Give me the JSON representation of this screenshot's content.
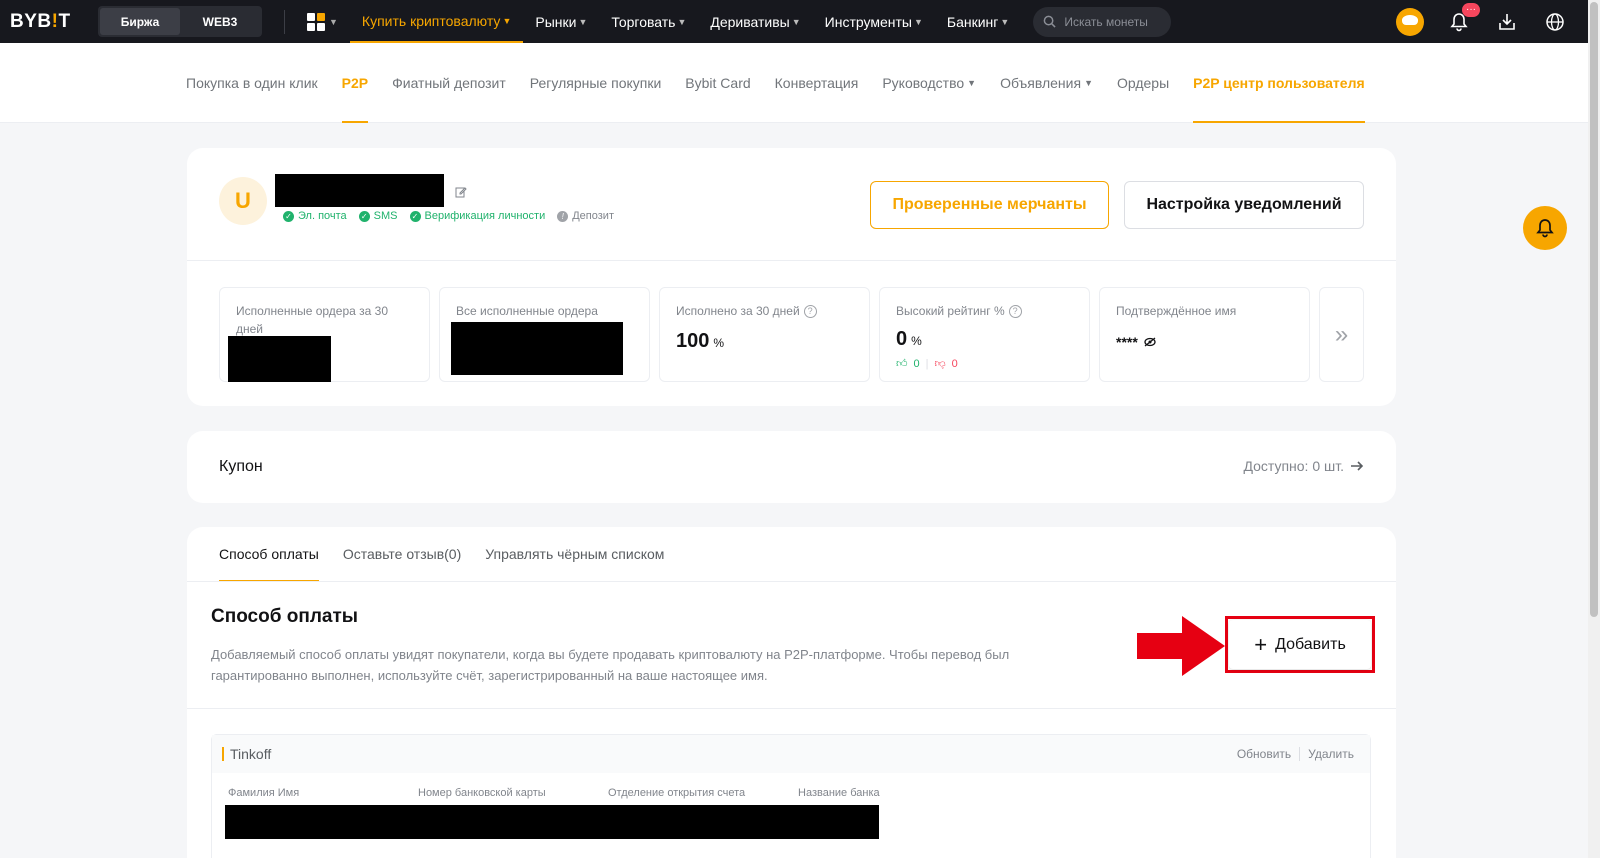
{
  "topbar": {
    "logo": "BYB",
    "logo_bar": "!",
    "logo_end": "T",
    "segments": [
      "Биржа",
      "WEB3"
    ],
    "nav": [
      {
        "label": "Купить криптовалюту",
        "active": true
      },
      {
        "label": "Рынки"
      },
      {
        "label": "Торговать"
      },
      {
        "label": "Деривативы"
      },
      {
        "label": "Инструменты"
      },
      {
        "label": "Банкинг"
      }
    ],
    "search_placeholder": "Искать монеты",
    "notif_badge": "···"
  },
  "subnav": [
    "Покупка в один клик",
    "P2P",
    "Фиатный депозит",
    "Регулярные покупки",
    "Bybit Card",
    "Конвертация",
    "Руководство",
    "Объявления",
    "Ордеры",
    "P2P центр пользователя"
  ],
  "profile": {
    "avatar_letter": "U",
    "badges": {
      "email": "Эл. почта",
      "sms": "SMS",
      "kyc": "Верификация личности",
      "deposit": "Депозит"
    },
    "btn_merchants": "Проверенные мерчанты",
    "btn_notifications": "Настройка уведомлений",
    "stats": {
      "orders30_label": "Исполненные ордера за 30 дней",
      "orders_all_label": "Все исполненные ордера",
      "completion_label": "Исполнено за 30 дней",
      "completion_value": "100",
      "rating_label": "Высокий рейтинг %",
      "rating_value": "0",
      "percent": "%",
      "likes": "0",
      "dislikes": "0",
      "name_label": "Подтверждённое имя",
      "name_value": "****"
    }
  },
  "coupon": {
    "title": "Купон",
    "available": "Доступно: 0 шт."
  },
  "payment": {
    "tabs": [
      "Способ оплаты",
      "Оставьте отзыв(0)",
      "Управлять чёрным списком"
    ],
    "title": "Способ оплаты",
    "description": "Добавляемый способ оплаты увидят покупатели, когда вы будете продавать криптовалюту на P2P-платформе. Чтобы перевод был гарантированно выполнен, используйте счёт, зарегистрированный на ваше настоящее имя.",
    "add_label": "Добавить",
    "bank": {
      "name": "Tinkoff",
      "update": "Обновить",
      "delete": "Удалить",
      "columns": [
        "Фамилия Имя",
        "Номер банковской карты",
        "Отделение открытия счета",
        "Название банка"
      ]
    }
  },
  "colors": {
    "accent": "#f7a600",
    "highlight": "#e60012",
    "success": "#20b26c",
    "danger": "#f6465d"
  }
}
